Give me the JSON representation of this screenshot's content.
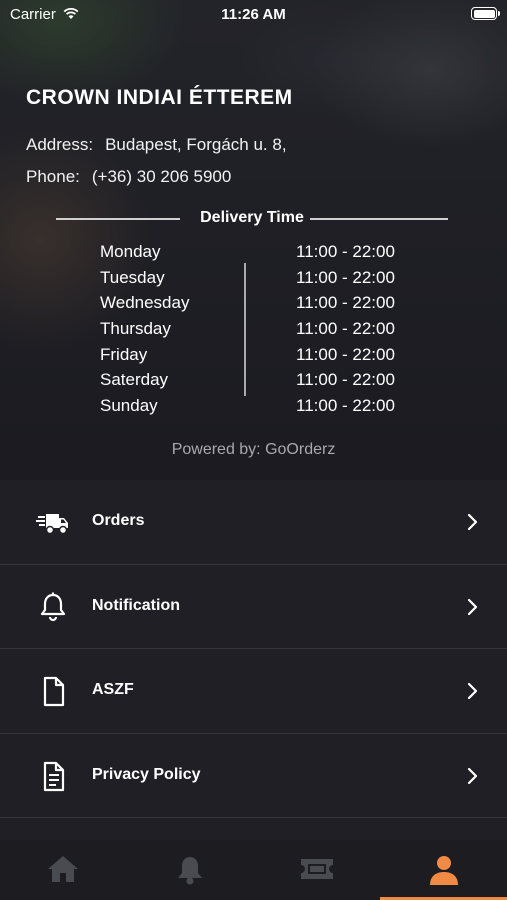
{
  "status_bar": {
    "carrier": "Carrier",
    "time": "11:26 AM"
  },
  "restaurant": {
    "name": "CROWN INDIAI ÉTTEREM",
    "address_label": "Address:",
    "address": "Budapest, Forgách u. 8,",
    "phone_label": "Phone:",
    "phone": "(+36) 30 206 5900"
  },
  "delivery": {
    "title": "Delivery Time",
    "schedule": [
      {
        "day": "Monday",
        "hours": "11:00 - 22:00"
      },
      {
        "day": "Tuesday",
        "hours": "11:00 - 22:00"
      },
      {
        "day": "Wednesday",
        "hours": "11:00 - 22:00"
      },
      {
        "day": "Thursday",
        "hours": "11:00 - 22:00"
      },
      {
        "day": "Friday",
        "hours": "11:00 - 22:00"
      },
      {
        "day": "Saterday",
        "hours": "11:00 - 22:00"
      },
      {
        "day": "Sunday",
        "hours": "11:00 - 22:00"
      }
    ]
  },
  "powered_by": "Powered by: GoOrderz",
  "menu": [
    {
      "label": "Orders",
      "icon": "delivery-truck-icon"
    },
    {
      "label": "Notification",
      "icon": "bell-icon"
    },
    {
      "label": "ASZF",
      "icon": "document-icon"
    },
    {
      "label": "Privacy Policy",
      "icon": "document-lines-icon"
    }
  ],
  "tabbar": {
    "tabs": [
      {
        "icon": "home-icon",
        "active": false
      },
      {
        "icon": "bell-icon",
        "active": false
      },
      {
        "icon": "ticket-icon",
        "active": false
      },
      {
        "icon": "user-icon",
        "active": true
      }
    ],
    "accent_color": "#f08a45",
    "inactive_color": "#4a4b51"
  }
}
